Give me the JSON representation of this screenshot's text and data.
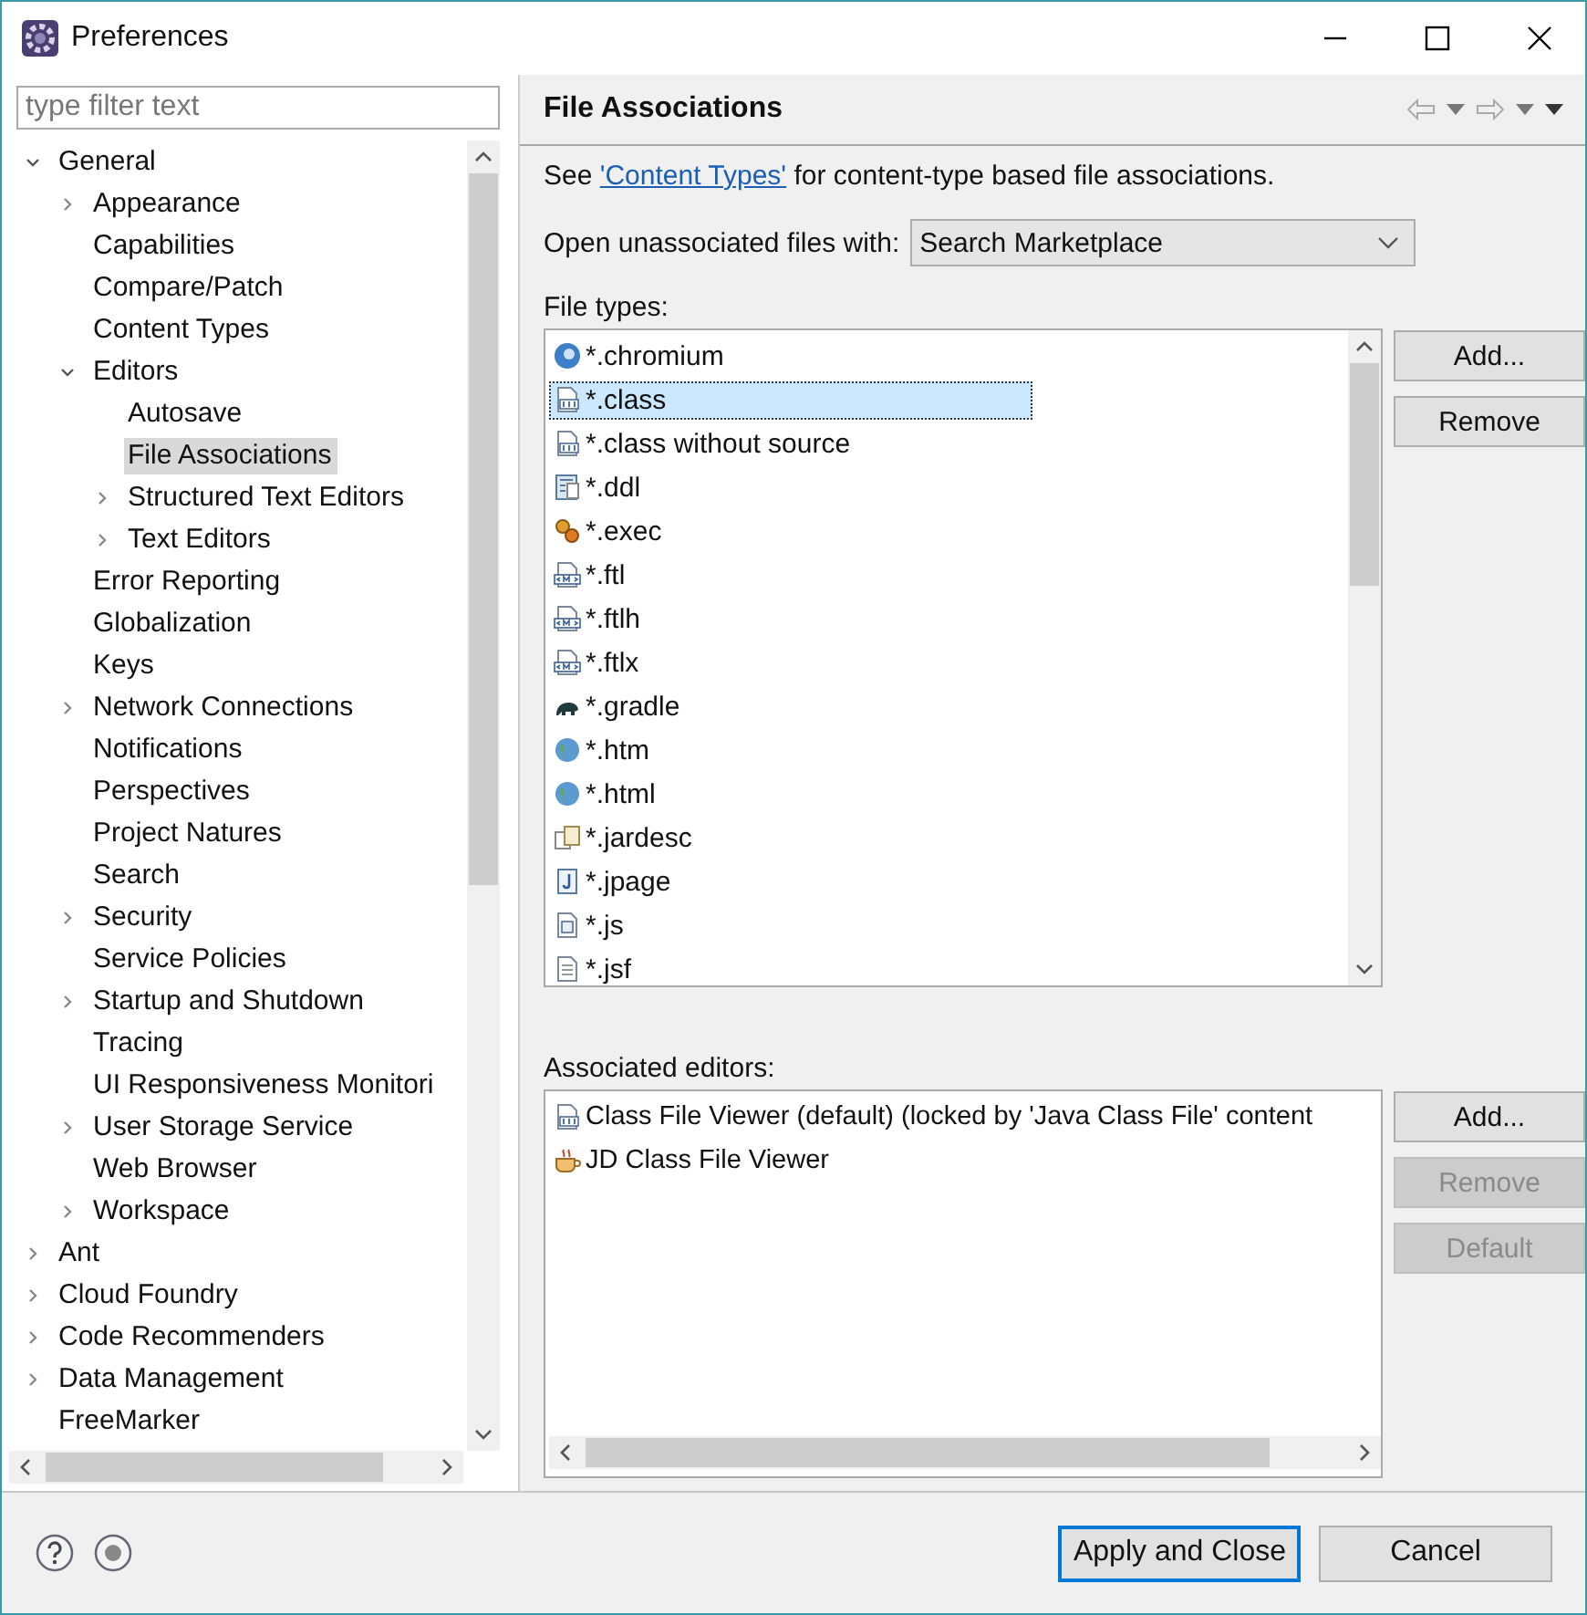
{
  "window": {
    "title": "Preferences"
  },
  "filter": {
    "placeholder": "type filter text"
  },
  "tree": [
    {
      "label": "General",
      "expanded": true,
      "selected": false,
      "children": [
        {
          "label": "Appearance",
          "expanded": false,
          "selected": false
        },
        {
          "label": "Capabilities",
          "selected": false
        },
        {
          "label": "Compare/Patch",
          "selected": false
        },
        {
          "label": "Content Types",
          "selected": false
        },
        {
          "label": "Editors",
          "expanded": true,
          "selected": false,
          "children": [
            {
              "label": "Autosave",
              "selected": false
            },
            {
              "label": "File Associations",
              "selected": true
            },
            {
              "label": "Structured Text Editors",
              "expanded": false,
              "selected": false
            },
            {
              "label": "Text Editors",
              "expanded": false,
              "selected": false
            }
          ]
        },
        {
          "label": "Error Reporting",
          "selected": false
        },
        {
          "label": "Globalization",
          "selected": false
        },
        {
          "label": "Keys",
          "selected": false
        },
        {
          "label": "Network Connections",
          "expanded": false,
          "selected": false
        },
        {
          "label": "Notifications",
          "selected": false
        },
        {
          "label": "Perspectives",
          "selected": false
        },
        {
          "label": "Project Natures",
          "selected": false
        },
        {
          "label": "Search",
          "selected": false
        },
        {
          "label": "Security",
          "expanded": false,
          "selected": false
        },
        {
          "label": "Service Policies",
          "selected": false
        },
        {
          "label": "Startup and Shutdown",
          "expanded": false,
          "selected": false
        },
        {
          "label": "Tracing",
          "selected": false
        },
        {
          "label": "UI Responsiveness Monitori",
          "selected": false
        },
        {
          "label": "User Storage Service",
          "expanded": false,
          "selected": false
        },
        {
          "label": "Web Browser",
          "selected": false
        },
        {
          "label": "Workspace",
          "expanded": false,
          "selected": false
        }
      ]
    },
    {
      "label": "Ant",
      "expanded": false,
      "selected": false
    },
    {
      "label": "Cloud Foundry",
      "expanded": false,
      "selected": false
    },
    {
      "label": "Code Recommenders",
      "expanded": false,
      "selected": false
    },
    {
      "label": "Data Management",
      "expanded": false,
      "selected": false
    },
    {
      "label": "FreeMarker",
      "selected": false
    }
  ],
  "page": {
    "title": "File Associations",
    "intro": {
      "before": "See ",
      "link": "'Content Types'",
      "after": " for content-type based file associations."
    },
    "open_with": {
      "label": "Open unassociated files with:",
      "value": "Search Marketplace"
    },
    "file_types": {
      "label": "File types:",
      "items": [
        {
          "name": "*.chromium",
          "kind": "chromium",
          "selected": false
        },
        {
          "name": "*.class",
          "kind": "binary",
          "selected": true
        },
        {
          "name": "*.class without source",
          "kind": "binary",
          "selected": false
        },
        {
          "name": "*.ddl",
          "kind": "table",
          "selected": false
        },
        {
          "name": "*.exec",
          "kind": "gears",
          "selected": false
        },
        {
          "name": "*.ftl",
          "kind": "template",
          "selected": false
        },
        {
          "name": "*.ftlh",
          "kind": "template",
          "selected": false
        },
        {
          "name": "*.ftlx",
          "kind": "template",
          "selected": false
        },
        {
          "name": "*.gradle",
          "kind": "gradle",
          "selected": false
        },
        {
          "name": "*.htm",
          "kind": "web",
          "selected": false
        },
        {
          "name": "*.html",
          "kind": "web",
          "selected": false
        },
        {
          "name": "*.jardesc",
          "kind": "package",
          "selected": false
        },
        {
          "name": "*.jpage",
          "kind": "jpage",
          "selected": false
        },
        {
          "name": "*.js",
          "kind": "script",
          "selected": false
        },
        {
          "name": "*.jsf",
          "kind": "document",
          "selected": false
        }
      ],
      "buttons": [
        {
          "label": "Add...",
          "disabled": false
        },
        {
          "label": "Remove",
          "disabled": false
        }
      ]
    },
    "editors": {
      "label": "Associated editors:",
      "items": [
        {
          "name": "Class File Viewer (default) (locked by 'Java Class File' content",
          "kind": "binary",
          "selected": false
        },
        {
          "name": "JD Class File Viewer",
          "kind": "decompiler",
          "selected": false
        }
      ],
      "buttons": [
        {
          "label": "Add...",
          "disabled": false
        },
        {
          "label": "Remove",
          "disabled": true
        },
        {
          "label": "Default",
          "disabled": true
        }
      ]
    }
  },
  "footer": {
    "buttons": [
      {
        "label": "Apply and Close",
        "default": true
      },
      {
        "label": "Cancel",
        "default": false
      }
    ]
  }
}
